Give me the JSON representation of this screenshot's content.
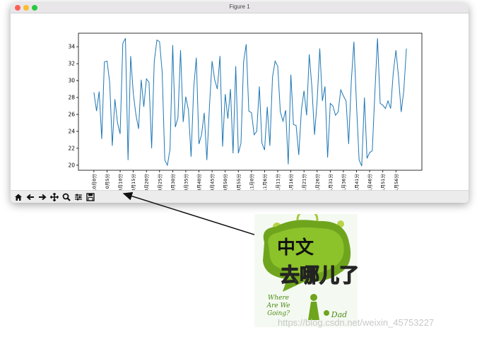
{
  "window": {
    "title": "Figure 1"
  },
  "toolbar": {
    "buttons": [
      {
        "name": "home-icon",
        "glyph": "⌂"
      },
      {
        "name": "back-icon",
        "glyph": "←"
      },
      {
        "name": "forward-icon",
        "glyph": "→"
      },
      {
        "name": "pan-icon",
        "glyph": "✥"
      },
      {
        "name": "zoom-icon",
        "glyph": "🔍"
      },
      {
        "name": "configure-subplots-icon",
        "glyph": "☷"
      },
      {
        "name": "save-icon",
        "glyph": "💾"
      }
    ]
  },
  "chart_data": {
    "type": "line",
    "title": "",
    "xlabel": "",
    "ylabel": "",
    "ylim": [
      19.4,
      35.6
    ],
    "yticks": [
      20,
      22,
      24,
      26,
      28,
      30,
      32,
      34
    ],
    "xtick_labels": [
      "10月0分",
      "0月5分",
      "0月10分",
      "0月15分",
      "0月20分",
      "0月25分",
      "0月30分",
      "0月35分",
      "0月40分",
      "0月45分",
      "0月50分",
      "0月55分",
      "11月0分",
      "11月6分",
      "11月11分",
      "11月16分",
      "1月21分",
      "1月26分",
      "1月31分",
      "1月36分",
      "1月41分",
      "1月46分",
      "1月51分",
      "1月56分"
    ],
    "color": "#1f77b4",
    "y": [
      28.6,
      26.4,
      28.7,
      23.1,
      32.2,
      32.3,
      29.8,
      22.3,
      27.8,
      25.0,
      23.7,
      34.4,
      35.0,
      20.6,
      32.9,
      28.5,
      26.0,
      24.3,
      30.1,
      26.9,
      30.2,
      29.8,
      22.0,
      32.3,
      34.8,
      34.6,
      31.0,
      20.6,
      20.0,
      21.9,
      34.2,
      24.5,
      25.6,
      33.6,
      25.1,
      28.1,
      26.5,
      21.0,
      29.1,
      32.7,
      22.5,
      23.6,
      26.2,
      20.6,
      26.9,
      32.3,
      30.1,
      29.0,
      32.9,
      22.2,
      28.4,
      25.5,
      29.0,
      21.4,
      31.7,
      21.4,
      22.6,
      32.2,
      34.3,
      26.4,
      26.2,
      23.6,
      24.0,
      29.3,
      22.6,
      21.8,
      26.9,
      22.3,
      30.4,
      32.3,
      31.7,
      26.3,
      25.2,
      26.5,
      20.1,
      30.7,
      24.8,
      24.7,
      21.2,
      26.5,
      28.8,
      25.9,
      33.1,
      29.3,
      23.6,
      27.6,
      33.8,
      27.6,
      29.3,
      20.9,
      27.3,
      27.0,
      25.9,
      26.3,
      28.9,
      28.2,
      27.6,
      22.5,
      29.9,
      34.6,
      27.1,
      20.6,
      19.9,
      28.0,
      20.8,
      21.5,
      21.7,
      28.6,
      35.0,
      27.3,
      27.1,
      26.7,
      27.6,
      26.7,
      30.9,
      33.6,
      30.4,
      26.3,
      28.8,
      33.8
    ]
  },
  "sticker": {
    "line1": "中文",
    "line2": "去哪儿了",
    "english1": "Where",
    "english2": "Are We",
    "english3": "Going?",
    "dad": "Dad"
  },
  "watermark": "https://blog.csdn.net/weixin_45753227"
}
